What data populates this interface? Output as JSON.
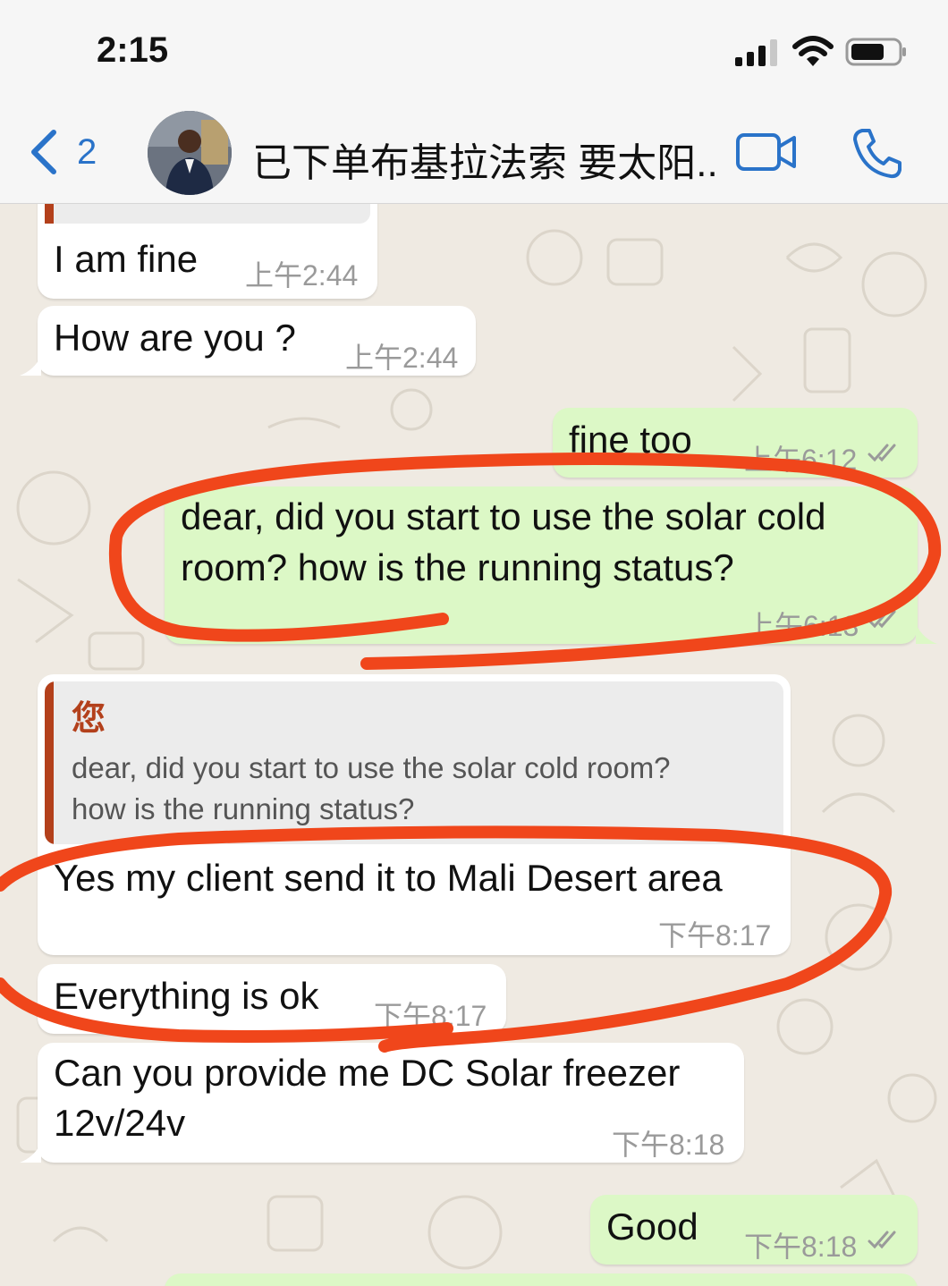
{
  "status_bar": {
    "time": "2:15"
  },
  "header": {
    "back_count": "2",
    "contact_name": "已下单布基拉法索 要太阳..."
  },
  "icons": {
    "back": "chevron-left-icon",
    "video": "video-camera-icon",
    "call": "phone-icon",
    "read_receipt": "double-check-icon",
    "signal": "cellular-signal-icon",
    "wifi": "wifi-icon",
    "battery": "battery-icon"
  },
  "colors": {
    "accent": "#2a73c9",
    "incoming_bubble": "#ffffff",
    "outgoing_bubble": "#dcf8c6",
    "quote_author": "#b3401b",
    "annotation": "#f0461b",
    "chat_background": "#efeae2"
  },
  "messages": [
    {
      "direction": "in",
      "text": "I am fine",
      "time": "上午2:44"
    },
    {
      "direction": "in",
      "text": "How are you ?",
      "time": "上午2:44"
    },
    {
      "direction": "out",
      "text": "fine too",
      "time": "上午6:12",
      "read": true
    },
    {
      "direction": "out",
      "text_line1": "dear, did you start to use the solar cold",
      "text_line2": "room? how is the running status?",
      "time": "上午6:13",
      "read": true
    },
    {
      "direction": "in",
      "quote_author": "您",
      "quote_line1": "dear, did you start to use the solar cold room?",
      "quote_line2": "how is the running status?",
      "text": "Yes my client send it to Mali Desert area",
      "time": "下午8:17"
    },
    {
      "direction": "in",
      "text": "Everything is ok",
      "time": "下午8:17"
    },
    {
      "direction": "in",
      "text_line1": "Can you provide me DC Solar freezer",
      "text_line2": "12v/24v",
      "time": "下午8:18"
    },
    {
      "direction": "out",
      "text": "Good",
      "time": "下午8:18",
      "read": true
    }
  ]
}
